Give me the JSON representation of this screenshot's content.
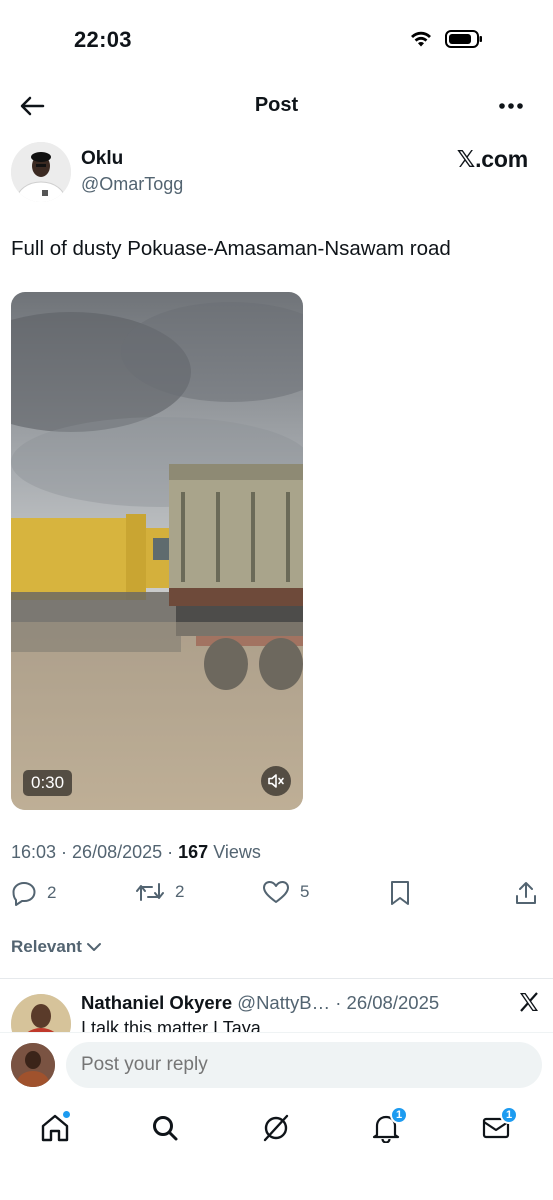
{
  "status_bar": {
    "time": "22:03"
  },
  "header": {
    "title": "Post"
  },
  "author": {
    "name": "Oklu",
    "handle": "@OmarTogg",
    "brand": "𝕏.com"
  },
  "post": {
    "text": "Full of dusty Pokuase-Amasaman-Nsawam road",
    "video_duration": "0:30",
    "time": "16:03",
    "date": "26/08/2025",
    "views_count": "167",
    "views_label": "Views",
    "separator": " · "
  },
  "actions": {
    "replies": "2",
    "reposts": "2",
    "likes": "5"
  },
  "sort": {
    "label": "Relevant"
  },
  "reply": {
    "name": "Nathaniel Okyere",
    "handle": "@NattyB…",
    "date": "· 26/08/2025",
    "text": "I talk this matter I Taya"
  },
  "composer": {
    "placeholder": "Post your reply"
  },
  "tabbar": {
    "notifications_badge": "1",
    "messages_badge": "1"
  },
  "colors": {
    "accent": "#1d9bf0",
    "text": "#0f1419",
    "muted": "#536471"
  },
  "icons": [
    "back-arrow-icon",
    "more-icon",
    "reply-icon",
    "repost-icon",
    "like-icon",
    "bookmark-icon",
    "share-icon",
    "home-icon",
    "search-icon",
    "grok-icon",
    "bell-icon",
    "mail-icon",
    "mute-icon",
    "x-logo-icon",
    "chevron-down-icon",
    "wifi-icon",
    "battery-icon"
  ]
}
